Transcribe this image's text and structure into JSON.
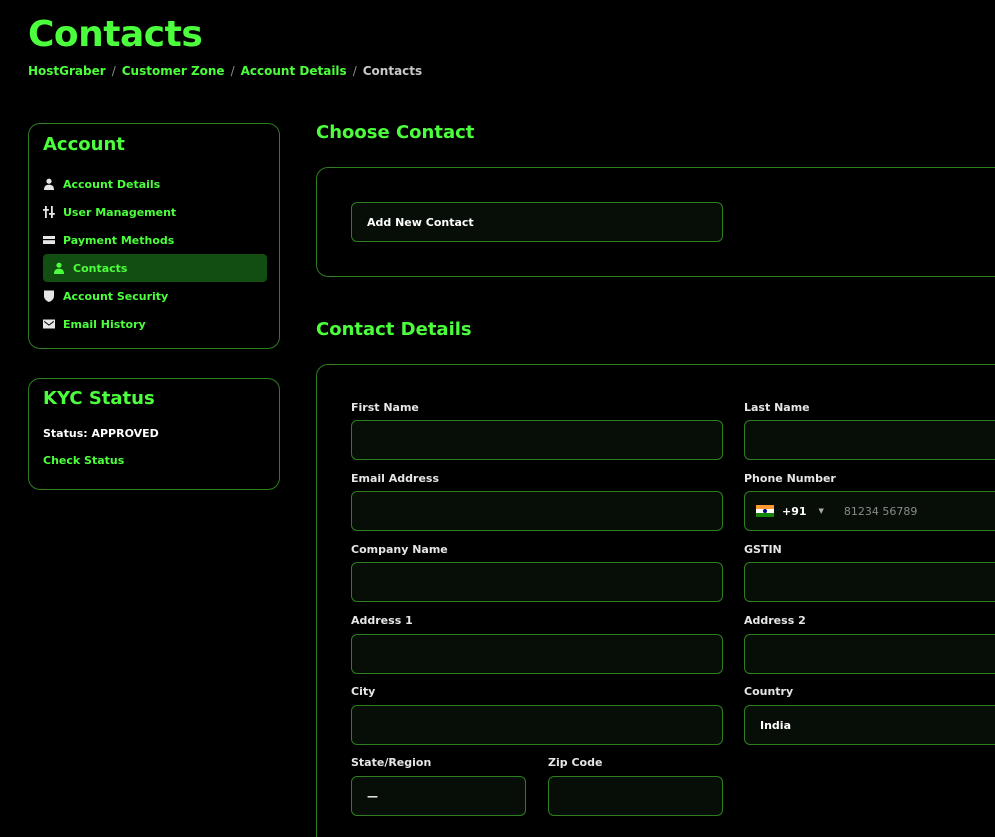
{
  "page": {
    "title": "Contacts",
    "breadcrumb": [
      "HostGraber",
      "Customer Zone",
      "Account Details",
      "Contacts"
    ]
  },
  "colors": {
    "accent": "#4cff3c",
    "border": "#2e7d1f",
    "active_bg": "#124d12",
    "background": "#000000"
  },
  "sidebar": {
    "account": {
      "title": "Account",
      "items": [
        {
          "label": "Account Details",
          "icon": "user-icon",
          "active": false
        },
        {
          "label": "User Management",
          "icon": "sliders-icon",
          "active": false
        },
        {
          "label": "Payment Methods",
          "icon": "credit-card-icon",
          "active": false
        },
        {
          "label": "Contacts",
          "icon": "user-icon",
          "active": true
        },
        {
          "label": "Account Security",
          "icon": "shield-icon",
          "active": false
        },
        {
          "label": "Email History",
          "icon": "envelope-icon",
          "active": false
        }
      ]
    },
    "kyc": {
      "title": "KYC Status",
      "status": "Status: APPROVED",
      "link": "Check Status"
    }
  },
  "choose_contact": {
    "heading": "Choose Contact",
    "selected": "Add New Contact"
  },
  "contact_details": {
    "heading": "Contact Details",
    "first_name": {
      "label": "First Name",
      "value": ""
    },
    "last_name": {
      "label": "Last Name",
      "value": ""
    },
    "email": {
      "label": "Email Address",
      "value": ""
    },
    "phone": {
      "label": "Phone Number",
      "dial_code": "+91",
      "flag": "india-flag-icon",
      "placeholder": "81234 56789",
      "value": ""
    },
    "company": {
      "label": "Company Name",
      "value": ""
    },
    "gstin": {
      "label": "GSTIN",
      "value": ""
    },
    "address1": {
      "label": "Address 1",
      "value": ""
    },
    "address2": {
      "label": "Address 2",
      "value": ""
    },
    "city": {
      "label": "City",
      "value": ""
    },
    "country": {
      "label": "Country",
      "value": "India"
    },
    "state": {
      "label": "State/Region",
      "value": "—"
    },
    "zip": {
      "label": "Zip Code",
      "value": ""
    }
  }
}
